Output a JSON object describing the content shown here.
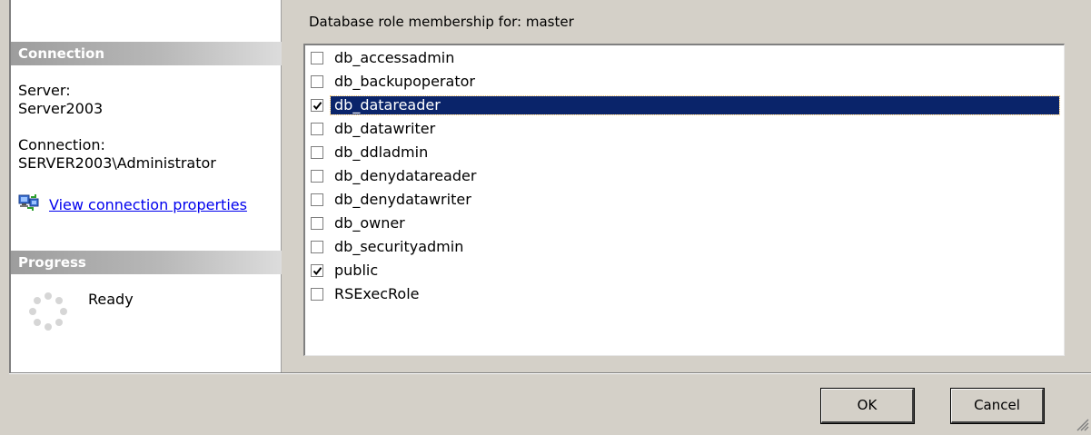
{
  "connection": {
    "header": "Connection",
    "server_label": "Server:",
    "server_value": "Server2003",
    "connection_label": "Connection:",
    "connection_value": "SERVER2003\\Administrator",
    "link_text": "View connection properties",
    "link_icon": "connection-properties-icon"
  },
  "progress": {
    "header": "Progress",
    "status": "Ready",
    "icon": "spinner-icon"
  },
  "roles": {
    "label": "Database role membership for: master",
    "items": [
      {
        "name": "db_accessadmin",
        "checked": false,
        "selected": false
      },
      {
        "name": "db_backupoperator",
        "checked": false,
        "selected": false
      },
      {
        "name": "db_datareader",
        "checked": true,
        "selected": true
      },
      {
        "name": "db_datawriter",
        "checked": false,
        "selected": false
      },
      {
        "name": "db_ddladmin",
        "checked": false,
        "selected": false
      },
      {
        "name": "db_denydatareader",
        "checked": false,
        "selected": false
      },
      {
        "name": "db_denydatawriter",
        "checked": false,
        "selected": false
      },
      {
        "name": "db_owner",
        "checked": false,
        "selected": false
      },
      {
        "name": "db_securityadmin",
        "checked": false,
        "selected": false
      },
      {
        "name": "public",
        "checked": true,
        "selected": false
      },
      {
        "name": "RSExecRole",
        "checked": false,
        "selected": false
      }
    ]
  },
  "buttons": {
    "ok": "OK",
    "cancel": "Cancel"
  },
  "colors": {
    "selection": "#0a246a",
    "link": "#0000ee",
    "dialog_bg": "#d4d0c8"
  }
}
